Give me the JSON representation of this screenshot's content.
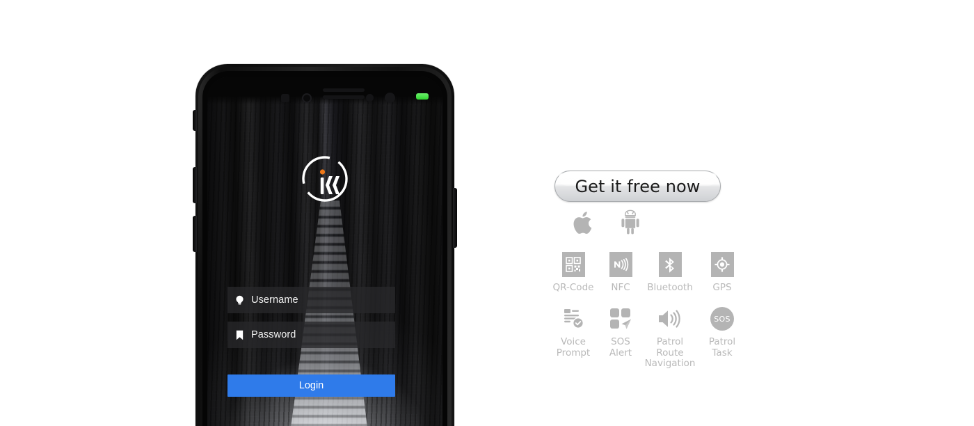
{
  "phone": {
    "status_led": "green-led-indicator",
    "app_logo_name": "app-logo",
    "login": {
      "username_placeholder": "Username",
      "password_placeholder": "Password",
      "username_icon": "bulb-icon",
      "password_icon": "bookmark-icon",
      "login_label": "Login",
      "login_color": "#2f7bea"
    }
  },
  "download": {
    "cta_label": "Get it free now",
    "stores": [
      {
        "name": "apple-store-icon",
        "label": "Apple"
      },
      {
        "name": "android-store-icon",
        "label": "Android"
      }
    ],
    "features_row1": [
      {
        "label": "QR-Code",
        "icon": "qr-code-icon"
      },
      {
        "label": "NFC",
        "icon": "nfc-icon"
      },
      {
        "label": "Bluetooth",
        "icon": "bluetooth-icon"
      },
      {
        "label": "GPS",
        "icon": "gps-icon"
      }
    ],
    "features_row2": [
      {
        "label": "Voice\nPrompt",
        "icon": "voice-prompt-icon"
      },
      {
        "label": "SOS\nAlert",
        "icon": "sos-alert-icon"
      },
      {
        "label": "Patrol Route\nNavigation",
        "icon": "patrol-route-navigation-icon"
      },
      {
        "label": "Patrol\nTask",
        "icon": "patrol-task-icon",
        "badge": "SOS"
      }
    ]
  },
  "colors": {
    "icon_gray": "#b4b4b4",
    "label_gray": "#b9b9b9",
    "accent_blue": "#2f7bea",
    "logo_dot_orange": "#f07818",
    "led_green": "#3ddb3d"
  }
}
